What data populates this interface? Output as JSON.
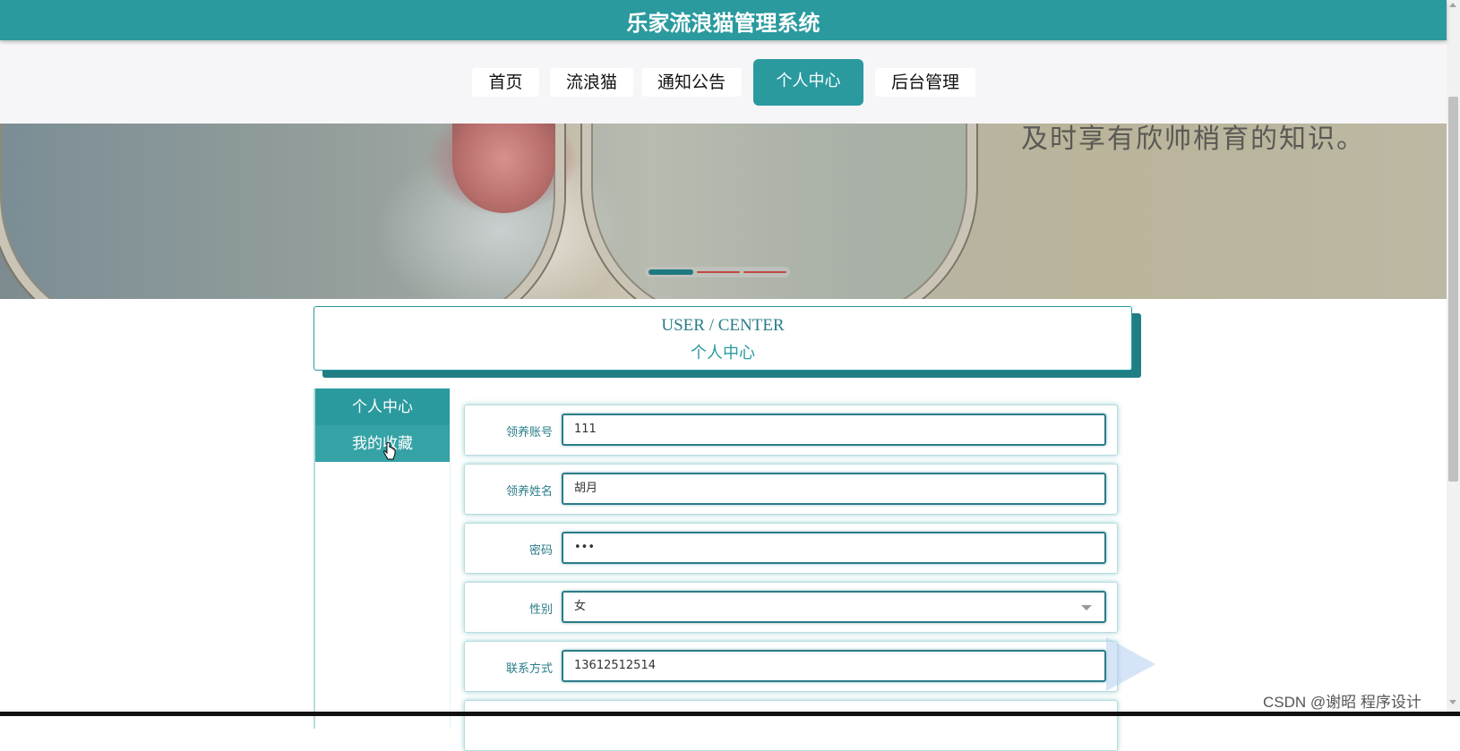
{
  "header": {
    "title": "乐家流浪猫管理系统"
  },
  "nav": {
    "items": [
      {
        "label": "首页"
      },
      {
        "label": "流浪猫"
      },
      {
        "label": "通知公告"
      },
      {
        "label": "个人中心"
      },
      {
        "label": "后台管理"
      }
    ],
    "active": "个人中心"
  },
  "banner": {
    "text_fragment": "及时享有欣帅梢育的知识。",
    "carousel_dots": 3,
    "active_dot": 1
  },
  "section": {
    "title_en": "USER / CENTER",
    "title_cn": "个人中心"
  },
  "sidebar": {
    "items": [
      {
        "label": "个人中心"
      },
      {
        "label": "我的收藏"
      }
    ]
  },
  "form": {
    "fields": [
      {
        "label": "领养账号",
        "value": "111"
      },
      {
        "label": "领养姓名",
        "value": "胡月"
      },
      {
        "label": "密码",
        "value": "•••"
      },
      {
        "label": "性别",
        "value": "女"
      },
      {
        "label": "联系方式",
        "value": "13612512514"
      }
    ]
  },
  "watermark": "CSDN @谢昭 程序设计",
  "colors": {
    "primary": "#2a9a9f",
    "dark_teal": "#2a7c88",
    "nav_bg": "#f6f6f8"
  },
  "icons": {
    "cursor": "hand-pointer-icon",
    "select_caret": "chevron-down-icon"
  }
}
